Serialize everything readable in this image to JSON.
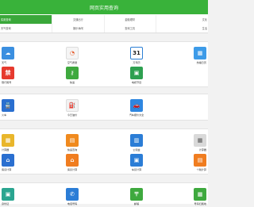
{
  "header": {
    "title": "网页实用查询"
  },
  "nav": {
    "row1": [
      "实用查询",
      "交通出行",
      "金融理财",
      "文化"
    ],
    "row2": [
      "天气查询",
      "娱乐休闲",
      "查询工具",
      "生活"
    ]
  },
  "sections": [
    {
      "tiles": [
        {
          "label": "天气",
          "icon": "weather-icon",
          "color": "#3b8fe0",
          "glyph": "☁"
        },
        {
          "label": "空气质量",
          "icon": "air-quality-icon",
          "color": "#f5f5f5",
          "glyph": "◔"
        },
        {
          "label": "万年历",
          "icon": "calendar-icon",
          "color": "#2b7fd4",
          "glyph": "31"
        },
        {
          "label": "热播日历",
          "icon": "hot-calendar-icon",
          "color": "#3d9be8",
          "glyph": "▦"
        },
        {
          "label": "限行尾号",
          "icon": "restriction-icon",
          "color": "#e63a2e",
          "glyph": "禁"
        },
        {
          "label": "快递",
          "icon": "key-icon",
          "color": "#3ea93e",
          "glyph": "⚷"
        },
        {
          "label": "电视节目",
          "icon": "tv-icon",
          "color": "#2ea050",
          "glyph": "▣"
        }
      ]
    },
    {
      "tiles": [
        {
          "label": "火车",
          "icon": "train-icon",
          "color": "#2a6fd0",
          "glyph": "🚆"
        },
        {
          "label": "今日油价",
          "icon": "fuel-icon",
          "color": "#f2f2f2",
          "glyph": "⛽"
        },
        {
          "label": "汽车报价大全",
          "icon": "car-price-icon",
          "color": "#2e86e0",
          "glyph": "🚗"
        }
      ]
    },
    {
      "tiles": [
        {
          "label": "计算器",
          "icon": "calculator-icon",
          "color": "#e9b62b",
          "glyph": "▦"
        },
        {
          "label": "快递查询",
          "icon": "package-icon",
          "color": "#f08a1e",
          "glyph": "▤"
        },
        {
          "label": "公积金",
          "icon": "funds-icon",
          "color": "#2b7dd6",
          "glyph": "▥"
        },
        {
          "label": "计算器",
          "icon": "calc2-icon",
          "color": "#d9d9d9",
          "glyph": "▦"
        },
        {
          "label": "房贷计算",
          "icon": "house-loan-icon",
          "color": "#2a6fd0",
          "glyph": "⌂"
        },
        {
          "label": "房贷计算",
          "icon": "house-icon",
          "color": "#f07d20",
          "glyph": "⌂"
        },
        {
          "label": "车贷计算",
          "icon": "car-loan-icon",
          "color": "#2b7dd6",
          "glyph": "▣"
        },
        {
          "label": "个税计算",
          "icon": "tax-icon",
          "color": "#f07d20",
          "glyph": "▤"
        }
      ]
    },
    {
      "tiles": [
        {
          "label": "身份证",
          "icon": "id-card-icon",
          "color": "#2aa590",
          "glyph": "▣"
        },
        {
          "label": "电话号码",
          "icon": "phone-icon",
          "color": "#2b7dd6",
          "glyph": "✆"
        },
        {
          "label": "邮编",
          "icon": "zipcode-icon",
          "color": "#3ea93e",
          "glyph": "〒"
        },
        {
          "label": "号码归属地",
          "icon": "number-icon",
          "color": "#3ea93e",
          "glyph": "▦"
        }
      ]
    }
  ]
}
